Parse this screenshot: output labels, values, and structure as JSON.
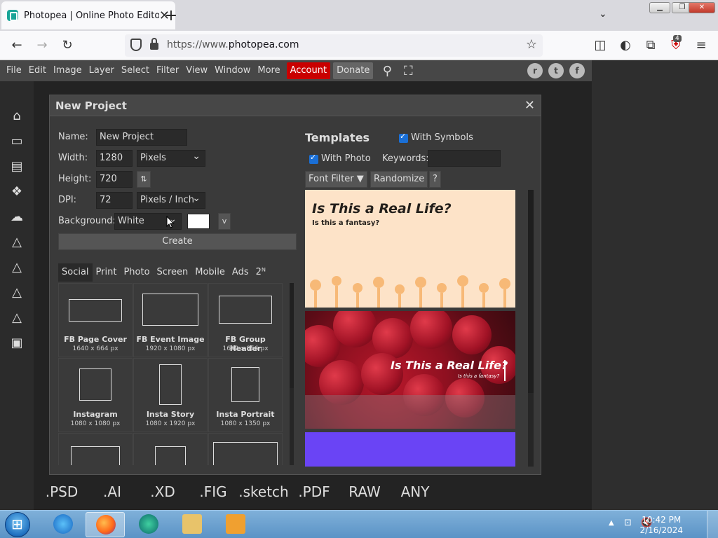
{
  "browser": {
    "tab_title": "Photopea | Online Photo Editor",
    "url_prefix": "https://www.",
    "url_domain": "photopea.com",
    "extension_badge": "4"
  },
  "menu": {
    "items": [
      "File",
      "Edit",
      "Image",
      "Layer",
      "Select",
      "Filter",
      "View",
      "Window",
      "More"
    ],
    "account": "Account",
    "donate": "Donate"
  },
  "formats": [
    ".PSD",
    ".AI",
    ".XD",
    ".FIG",
    ".sketch",
    ".PDF",
    "RAW",
    "ANY"
  ],
  "dialog": {
    "title": "New Project",
    "name_label": "Name:",
    "name_value": "New Project",
    "width_label": "Width:",
    "width_value": "1280",
    "width_unit": "Pixels",
    "height_label": "Height:",
    "height_value": "720",
    "swap_glyph": "⇅",
    "dpi_label": "DPI:",
    "dpi_value": "72",
    "dpi_unit": "Pixels / Inch",
    "background_label": "Background:",
    "background_value": "White",
    "background_color": "#ffffff",
    "v_button": "v",
    "create_label": "Create",
    "categories": [
      "Social",
      "Print",
      "Photo",
      "Screen",
      "Mobile",
      "Ads",
      "2ᴺ"
    ],
    "active_category": "Social",
    "presets": [
      {
        "name": "FB Page Cover",
        "size": "1640 x 664 px"
      },
      {
        "name": "FB Event Image",
        "size": "1920 x 1080 px"
      },
      {
        "name": "FB Group Header",
        "size": "1640 x 856 px"
      },
      {
        "name": "Instagram",
        "size": "1080 x 1080 px"
      },
      {
        "name": "Insta Story",
        "size": "1080 x 1920 px"
      },
      {
        "name": "Insta Portrait",
        "size": "1080 x 1350 px"
      }
    ],
    "templates_title": "Templates",
    "with_symbols": "With Symbols",
    "with_photo": "With Photo",
    "keywords_label": "Keywords:",
    "font_filter": "Font Filter ▼",
    "randomize": "Randomize",
    "help": "?",
    "template1_heading": "Is This a Real Life?",
    "template1_sub": "Is this a fantasy?",
    "template2_heading": "Is This a Real Life?",
    "template2_sub": "Is this a fantasy?"
  },
  "taskbar": {
    "time": "10:42 PM",
    "date": "2/16/2024"
  },
  "colors": {
    "account": "#c90000",
    "accent_check": "#1a6fd6",
    "template1_bg": "#fde3c8",
    "template3_bg": "#6a44f5"
  }
}
